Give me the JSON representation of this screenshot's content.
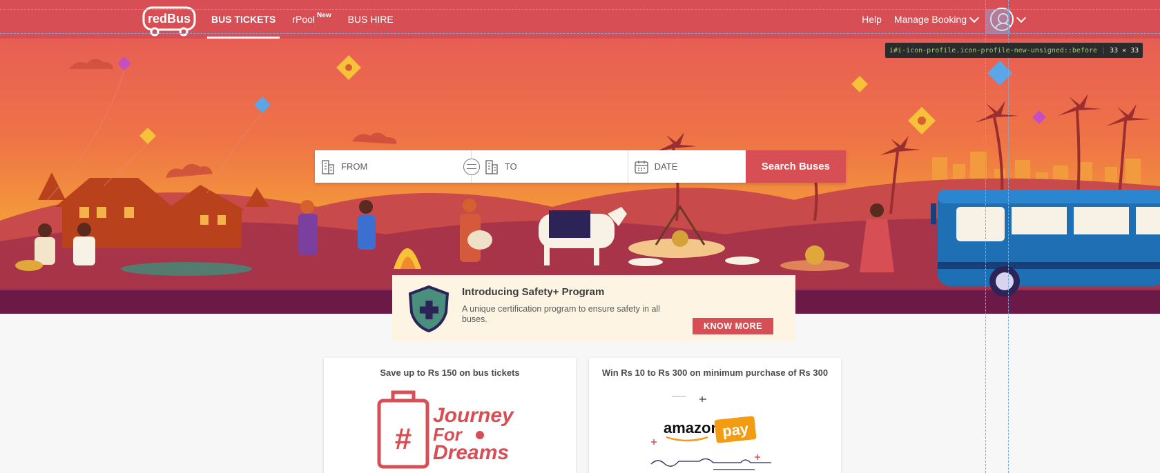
{
  "app": {
    "brand": "redBus",
    "accent_color": "#d84e55"
  },
  "nav": {
    "items": [
      {
        "label": "BUS TICKETS",
        "active": true
      },
      {
        "label": "rPool",
        "badge": "New",
        "active": false
      },
      {
        "label": "BUS HIRE",
        "active": false
      }
    ],
    "right": {
      "help": "Help",
      "manage_booking": "Manage Booking",
      "profile_icon": "profile-icon"
    }
  },
  "devtools": {
    "selector": "i#i-icon-profile.icon-profile-new-unsigned::before",
    "dimensions": "33 × 33"
  },
  "search": {
    "from_placeholder": "FROM",
    "to_placeholder": "TO",
    "date_placeholder": "DATE",
    "button_label": "Search Buses"
  },
  "safety": {
    "title": "Introducing Safety+ Program",
    "description": "A unique certification program to ensure safety in all buses.",
    "button_label": "KNOW MORE"
  },
  "offers": [
    {
      "title": "Save up to Rs 150 on bus tickets",
      "art_text": [
        "Journey",
        "For",
        "Dreams"
      ],
      "hash": "#"
    },
    {
      "title": "Win Rs 10 to Rs 300 on minimum purchase of Rs 300",
      "art_text": [
        "amazon",
        "pay"
      ]
    }
  ]
}
